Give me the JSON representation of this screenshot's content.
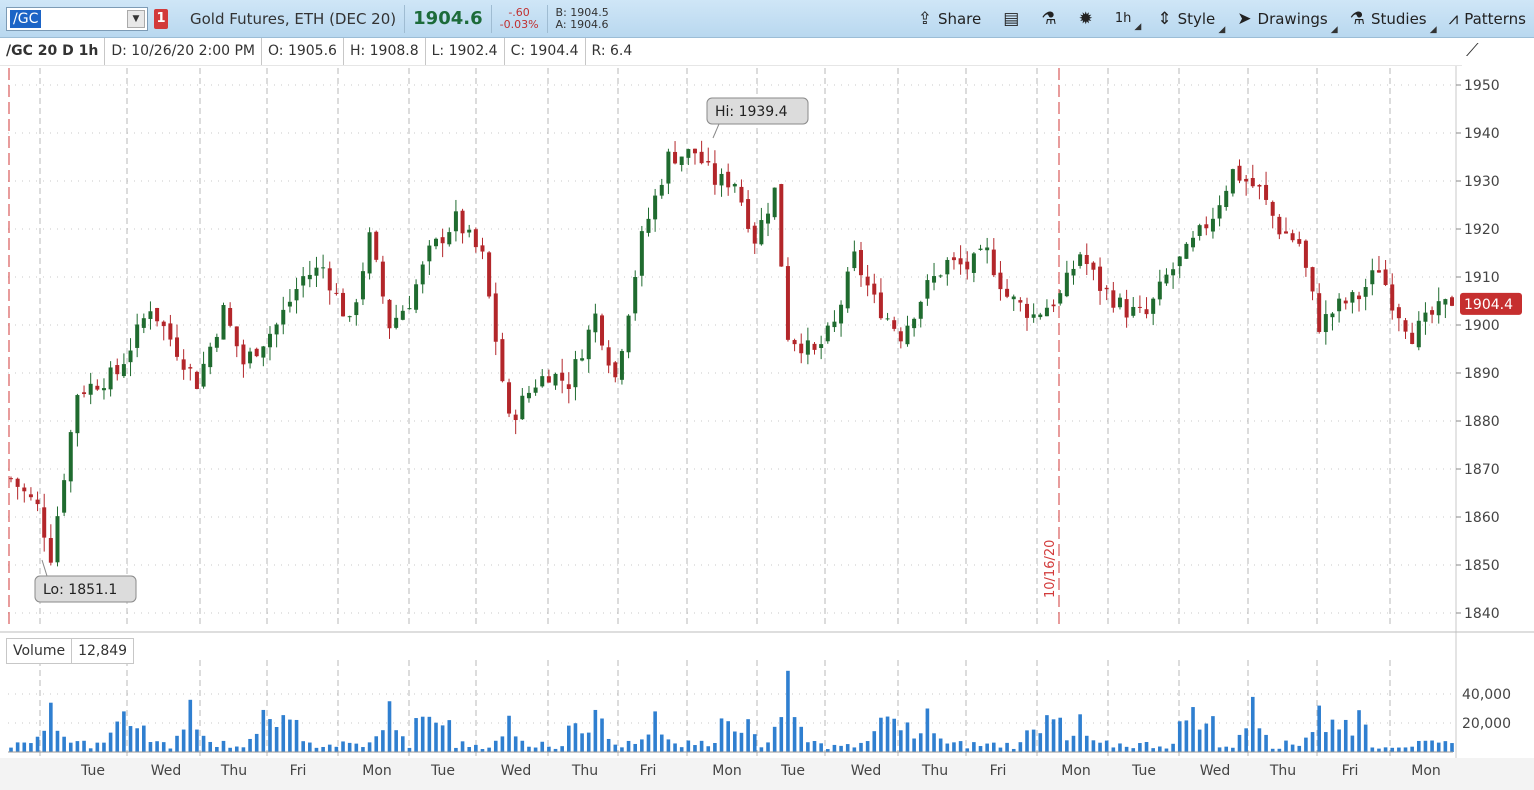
{
  "toolbar": {
    "symbol": "/GC",
    "link_badge": "1",
    "description": "Gold Futures, ETH (DEC 20)",
    "last": "1904.6",
    "change": "-.60",
    "change_pct": "-0.03%",
    "bid": "B: 1904.5",
    "ask": "A: 1904.6",
    "share": "Share",
    "timeframe": "1h",
    "style": "Style",
    "drawings": "Drawings",
    "studies": "Studies",
    "patterns": "Patterns"
  },
  "info": {
    "symbol": "/GC 20 D 1h",
    "date": "D: 10/26/20 2:00 PM",
    "open": "O: 1905.6",
    "high": "H: 1908.8",
    "low": "L: 1902.4",
    "close": "C: 1904.4",
    "range": "R: 6.4"
  },
  "volume_panel": {
    "label": "Volume",
    "value": "12,849"
  },
  "colors": {
    "up": "#1f6b2f",
    "down": "#b3262a",
    "volume": "#2f7fd0",
    "accent": "#d23a3a"
  },
  "chart_data": {
    "type": "candlestick",
    "title": "",
    "price_axis": {
      "ticks": [
        1840,
        1850,
        1860,
        1870,
        1880,
        1890,
        1900,
        1910,
        1920,
        1930,
        1940,
        1950
      ],
      "ylim": [
        1837,
        1955
      ]
    },
    "volume_axis": {
      "ticks": [
        "40,000",
        "20,000"
      ],
      "tick_values": [
        40000,
        20000
      ],
      "ylim": [
        0,
        60000
      ]
    },
    "last_price_label": "1904.4",
    "hi_label": "Hi: 1939.4",
    "lo_label": "Lo: 1851.1",
    "marker_label": "10/16/20",
    "x_labels": [
      "Tue",
      "Wed",
      "Thu",
      "Fri",
      "Mon",
      "Tue",
      "Wed",
      "Thu",
      "Fri",
      "Mon",
      "Tue",
      "Wed",
      "Thu",
      "Fri",
      "Mon",
      "Tue",
      "Wed",
      "Thu",
      "Fri",
      "Mon"
    ],
    "grid": true,
    "path": [
      [
        0,
        1868
      ],
      [
        4,
        1862
      ],
      [
        6,
        1852
      ],
      [
        10,
        1886
      ],
      [
        16,
        1890
      ],
      [
        21,
        1904
      ],
      [
        28,
        1888
      ],
      [
        32,
        1903
      ],
      [
        35,
        1892
      ],
      [
        40,
        1900
      ],
      [
        44,
        1910
      ],
      [
        47,
        1912
      ],
      [
        51,
        1900
      ],
      [
        54,
        1918
      ],
      [
        57,
        1900
      ],
      [
        60,
        1905
      ],
      [
        63,
        1915
      ],
      [
        67,
        1922
      ],
      [
        71,
        1914
      ],
      [
        75,
        1880
      ],
      [
        79,
        1888
      ],
      [
        81,
        1890
      ],
      [
        84,
        1888
      ],
      [
        88,
        1902
      ],
      [
        91,
        1889
      ],
      [
        95,
        1918
      ],
      [
        99,
        1935
      ],
      [
        103,
        1936
      ],
      [
        106,
        1930
      ],
      [
        109,
        1930
      ],
      [
        112,
        1918
      ],
      [
        115,
        1928
      ],
      [
        117,
        1898
      ],
      [
        121,
        1894
      ],
      [
        124,
        1900
      ],
      [
        127,
        1914
      ],
      [
        130,
        1905
      ],
      [
        134,
        1898
      ],
      [
        138,
        1908
      ],
      [
        141,
        1913
      ],
      [
        144,
        1912
      ],
      [
        147,
        1915
      ],
      [
        150,
        1906
      ],
      [
        154,
        1902
      ],
      [
        158,
        1906
      ],
      [
        161,
        1915
      ],
      [
        164,
        1908
      ],
      [
        168,
        1903
      ],
      [
        171,
        1902
      ],
      [
        174,
        1910
      ],
      [
        177,
        1915
      ],
      [
        181,
        1923
      ],
      [
        184,
        1932
      ],
      [
        188,
        1928
      ],
      [
        191,
        1920
      ],
      [
        194,
        1917
      ],
      [
        197,
        1900
      ],
      [
        200,
        1904
      ],
      [
        203,
        1906
      ],
      [
        206,
        1912
      ],
      [
        208,
        1905
      ],
      [
        211,
        1898
      ],
      [
        214,
        1902
      ],
      [
        217,
        1905
      ]
    ],
    "volume_spikes": [
      [
        6,
        34000
      ],
      [
        17,
        28000
      ],
      [
        27,
        36000
      ],
      [
        38,
        29000
      ],
      [
        57,
        35000
      ],
      [
        75,
        25000
      ],
      [
        88,
        29000
      ],
      [
        97,
        28000
      ],
      [
        117,
        56000
      ],
      [
        138,
        30000
      ],
      [
        161,
        26000
      ],
      [
        178,
        31000
      ],
      [
        187,
        38000
      ],
      [
        197,
        32000
      ]
    ]
  }
}
